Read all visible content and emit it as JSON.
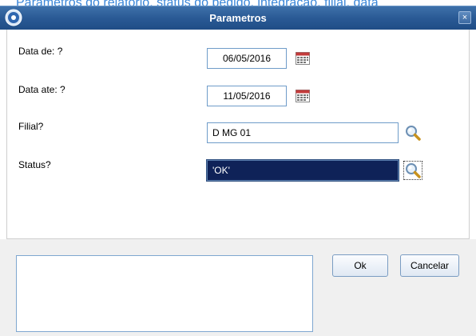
{
  "window": {
    "title": "Parametros",
    "close_label": "×",
    "background_text": "Parametros do relatorio, status do pedido, integração, filial, data"
  },
  "fields": [
    {
      "label": "Data de: ?",
      "value": "06/05/2016",
      "icon": "calendar-icon"
    },
    {
      "label": "Data ate: ?",
      "value": "11/05/2016",
      "icon": "calendar-icon"
    },
    {
      "label": "Filial?",
      "value": "D MG 01",
      "icon": "search-icon"
    },
    {
      "label": "Status?",
      "value": "'OK'",
      "icon": "search-icon",
      "selected": true
    }
  ],
  "buttons": {
    "ok": "Ok",
    "cancel": "Cancelar"
  },
  "colors": {
    "titlebar": "#2a5a95",
    "selection": "#0f2258",
    "field_border": "#6f9cc9",
    "footer": "#f0f0f0"
  }
}
